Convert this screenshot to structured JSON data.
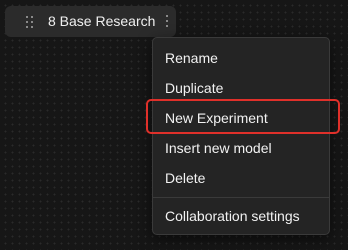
{
  "tab": {
    "drag_icon": "drag-handle-icon",
    "title": "8 Base Research",
    "menu_icon": "more-vertical-icon"
  },
  "context_menu": {
    "items": [
      {
        "label": "Rename"
      },
      {
        "label": "Duplicate"
      },
      {
        "label": "New Experiment"
      },
      {
        "label": "Insert new model"
      },
      {
        "label": "Delete"
      },
      {
        "label": "Collaboration settings"
      }
    ]
  },
  "annotation": {
    "highlight_color": "#e0302a",
    "highlighted_item": "New Experiment"
  },
  "colors": {
    "canvas_background": "#161616",
    "tab_background": "#2b2b2b",
    "menu_background": "#242424",
    "text": "#f2f2f2"
  }
}
